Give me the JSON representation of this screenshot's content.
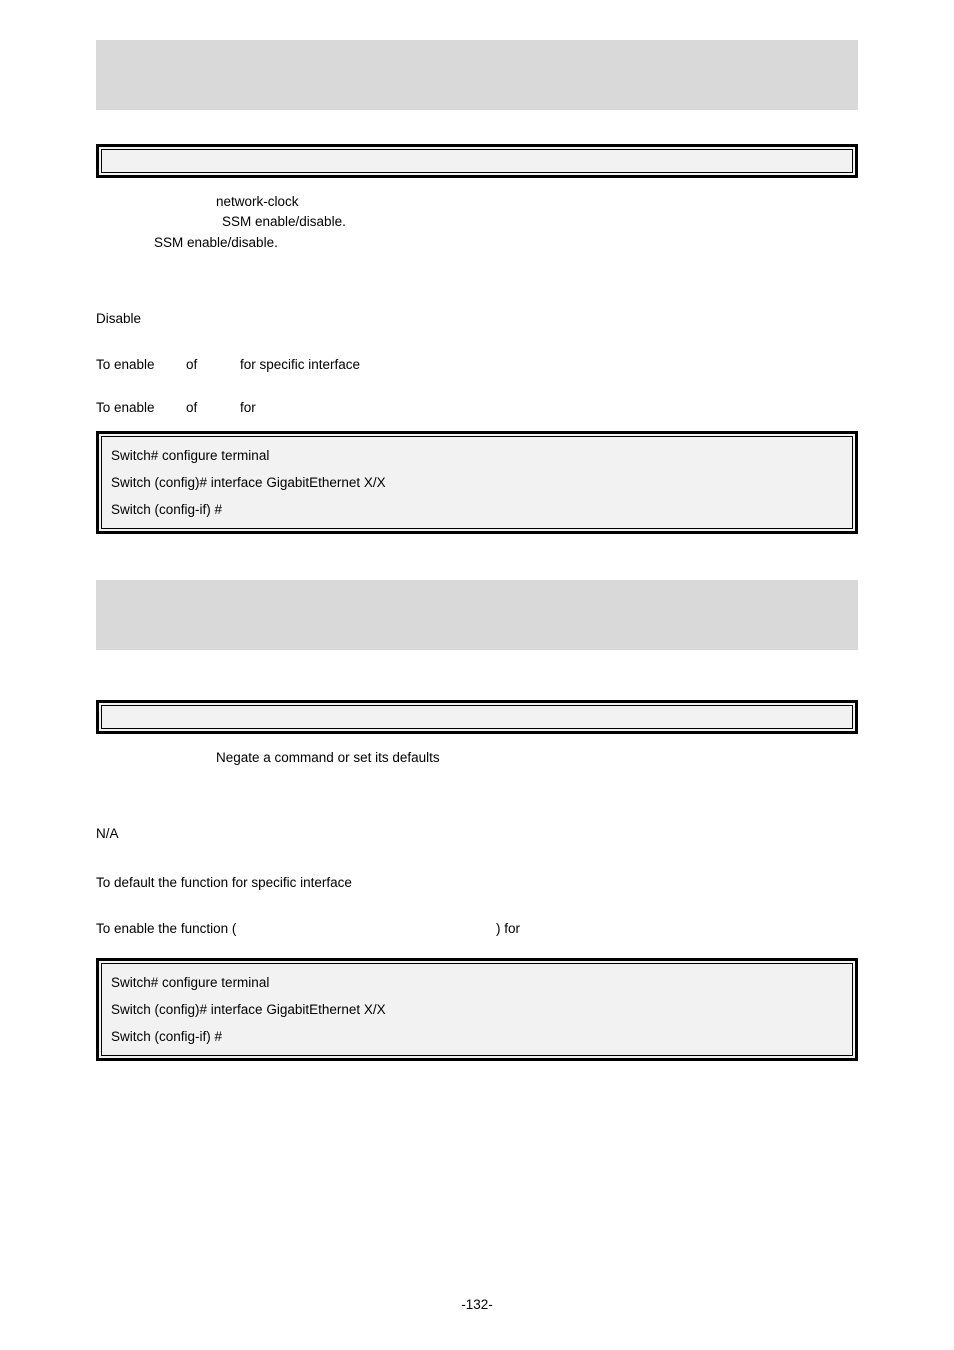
{
  "block1": {
    "desc_line1_pre": "network-clock",
    "desc_line2_pre": "SSM  enable/disable.",
    "desc_line3": "SSM enable/disable.",
    "default_value": "Disable",
    "usage_row": {
      "a": "To enable",
      "b": "of",
      "c": "for specific interface"
    },
    "example_row": {
      "a": "To enable",
      "b": "of",
      "c": "for"
    },
    "code": {
      "l1": "Switch# configure terminal",
      "l2": "Switch (config)# interface GigabitEthernet X/X",
      "l3": "Switch (config-if) #"
    }
  },
  "block2": {
    "desc": "Negate a command or set its defaults",
    "default_value": "N/A",
    "usage_line": "To default the function for specific interface",
    "example_pre": "To enable the function (",
    "example_post": ") for",
    "code": {
      "l1": "Switch# configure terminal",
      "l2": "Switch (config)# interface GigabitEthernet X/X",
      "l3": "Switch (config-if) #"
    }
  },
  "page_number": "-132-"
}
